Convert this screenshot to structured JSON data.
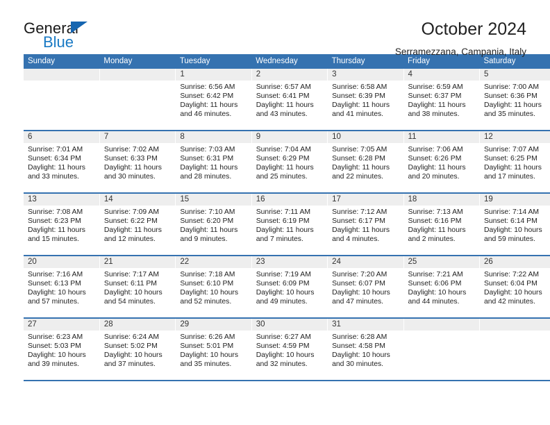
{
  "brand": {
    "name_part1": "General",
    "name_part2": "Blue",
    "triangle_color": "#1565b0",
    "blue_text_color": "#1879c4"
  },
  "header": {
    "title": "October 2024",
    "subtitle": "Serramezzana, Campania, Italy"
  },
  "theme": {
    "header_row_bg": "#3572b0",
    "header_row_text": "#ffffff",
    "daynum_bg": "#eeeeee",
    "row_separator": "#3572b0"
  },
  "weekdays": [
    "Sunday",
    "Monday",
    "Tuesday",
    "Wednesday",
    "Thursday",
    "Friday",
    "Saturday"
  ],
  "labels": {
    "sunrise_prefix": "Sunrise:",
    "sunset_prefix": "Sunset:",
    "daylight_prefix": "Daylight:"
  },
  "weeks": [
    [
      {
        "day": "",
        "sunrise": "",
        "sunset": "",
        "daylight_line1": "",
        "daylight_line2": ""
      },
      {
        "day": "",
        "sunrise": "",
        "sunset": "",
        "daylight_line1": "",
        "daylight_line2": ""
      },
      {
        "day": "1",
        "sunrise": "Sunrise: 6:56 AM",
        "sunset": "Sunset: 6:42 PM",
        "daylight_line1": "Daylight: 11 hours",
        "daylight_line2": "and 46 minutes."
      },
      {
        "day": "2",
        "sunrise": "Sunrise: 6:57 AM",
        "sunset": "Sunset: 6:41 PM",
        "daylight_line1": "Daylight: 11 hours",
        "daylight_line2": "and 43 minutes."
      },
      {
        "day": "3",
        "sunrise": "Sunrise: 6:58 AM",
        "sunset": "Sunset: 6:39 PM",
        "daylight_line1": "Daylight: 11 hours",
        "daylight_line2": "and 41 minutes."
      },
      {
        "day": "4",
        "sunrise": "Sunrise: 6:59 AM",
        "sunset": "Sunset: 6:37 PM",
        "daylight_line1": "Daylight: 11 hours",
        "daylight_line2": "and 38 minutes."
      },
      {
        "day": "5",
        "sunrise": "Sunrise: 7:00 AM",
        "sunset": "Sunset: 6:36 PM",
        "daylight_line1": "Daylight: 11 hours",
        "daylight_line2": "and 35 minutes."
      }
    ],
    [
      {
        "day": "6",
        "sunrise": "Sunrise: 7:01 AM",
        "sunset": "Sunset: 6:34 PM",
        "daylight_line1": "Daylight: 11 hours",
        "daylight_line2": "and 33 minutes."
      },
      {
        "day": "7",
        "sunrise": "Sunrise: 7:02 AM",
        "sunset": "Sunset: 6:33 PM",
        "daylight_line1": "Daylight: 11 hours",
        "daylight_line2": "and 30 minutes."
      },
      {
        "day": "8",
        "sunrise": "Sunrise: 7:03 AM",
        "sunset": "Sunset: 6:31 PM",
        "daylight_line1": "Daylight: 11 hours",
        "daylight_line2": "and 28 minutes."
      },
      {
        "day": "9",
        "sunrise": "Sunrise: 7:04 AM",
        "sunset": "Sunset: 6:29 PM",
        "daylight_line1": "Daylight: 11 hours",
        "daylight_line2": "and 25 minutes."
      },
      {
        "day": "10",
        "sunrise": "Sunrise: 7:05 AM",
        "sunset": "Sunset: 6:28 PM",
        "daylight_line1": "Daylight: 11 hours",
        "daylight_line2": "and 22 minutes."
      },
      {
        "day": "11",
        "sunrise": "Sunrise: 7:06 AM",
        "sunset": "Sunset: 6:26 PM",
        "daylight_line1": "Daylight: 11 hours",
        "daylight_line2": "and 20 minutes."
      },
      {
        "day": "12",
        "sunrise": "Sunrise: 7:07 AM",
        "sunset": "Sunset: 6:25 PM",
        "daylight_line1": "Daylight: 11 hours",
        "daylight_line2": "and 17 minutes."
      }
    ],
    [
      {
        "day": "13",
        "sunrise": "Sunrise: 7:08 AM",
        "sunset": "Sunset: 6:23 PM",
        "daylight_line1": "Daylight: 11 hours",
        "daylight_line2": "and 15 minutes."
      },
      {
        "day": "14",
        "sunrise": "Sunrise: 7:09 AM",
        "sunset": "Sunset: 6:22 PM",
        "daylight_line1": "Daylight: 11 hours",
        "daylight_line2": "and 12 minutes."
      },
      {
        "day": "15",
        "sunrise": "Sunrise: 7:10 AM",
        "sunset": "Sunset: 6:20 PM",
        "daylight_line1": "Daylight: 11 hours",
        "daylight_line2": "and 9 minutes."
      },
      {
        "day": "16",
        "sunrise": "Sunrise: 7:11 AM",
        "sunset": "Sunset: 6:19 PM",
        "daylight_line1": "Daylight: 11 hours",
        "daylight_line2": "and 7 minutes."
      },
      {
        "day": "17",
        "sunrise": "Sunrise: 7:12 AM",
        "sunset": "Sunset: 6:17 PM",
        "daylight_line1": "Daylight: 11 hours",
        "daylight_line2": "and 4 minutes."
      },
      {
        "day": "18",
        "sunrise": "Sunrise: 7:13 AM",
        "sunset": "Sunset: 6:16 PM",
        "daylight_line1": "Daylight: 11 hours",
        "daylight_line2": "and 2 minutes."
      },
      {
        "day": "19",
        "sunrise": "Sunrise: 7:14 AM",
        "sunset": "Sunset: 6:14 PM",
        "daylight_line1": "Daylight: 10 hours",
        "daylight_line2": "and 59 minutes."
      }
    ],
    [
      {
        "day": "20",
        "sunrise": "Sunrise: 7:16 AM",
        "sunset": "Sunset: 6:13 PM",
        "daylight_line1": "Daylight: 10 hours",
        "daylight_line2": "and 57 minutes."
      },
      {
        "day": "21",
        "sunrise": "Sunrise: 7:17 AM",
        "sunset": "Sunset: 6:11 PM",
        "daylight_line1": "Daylight: 10 hours",
        "daylight_line2": "and 54 minutes."
      },
      {
        "day": "22",
        "sunrise": "Sunrise: 7:18 AM",
        "sunset": "Sunset: 6:10 PM",
        "daylight_line1": "Daylight: 10 hours",
        "daylight_line2": "and 52 minutes."
      },
      {
        "day": "23",
        "sunrise": "Sunrise: 7:19 AM",
        "sunset": "Sunset: 6:09 PM",
        "daylight_line1": "Daylight: 10 hours",
        "daylight_line2": "and 49 minutes."
      },
      {
        "day": "24",
        "sunrise": "Sunrise: 7:20 AM",
        "sunset": "Sunset: 6:07 PM",
        "daylight_line1": "Daylight: 10 hours",
        "daylight_line2": "and 47 minutes."
      },
      {
        "day": "25",
        "sunrise": "Sunrise: 7:21 AM",
        "sunset": "Sunset: 6:06 PM",
        "daylight_line1": "Daylight: 10 hours",
        "daylight_line2": "and 44 minutes."
      },
      {
        "day": "26",
        "sunrise": "Sunrise: 7:22 AM",
        "sunset": "Sunset: 6:04 PM",
        "daylight_line1": "Daylight: 10 hours",
        "daylight_line2": "and 42 minutes."
      }
    ],
    [
      {
        "day": "27",
        "sunrise": "Sunrise: 6:23 AM",
        "sunset": "Sunset: 5:03 PM",
        "daylight_line1": "Daylight: 10 hours",
        "daylight_line2": "and 39 minutes."
      },
      {
        "day": "28",
        "sunrise": "Sunrise: 6:24 AM",
        "sunset": "Sunset: 5:02 PM",
        "daylight_line1": "Daylight: 10 hours",
        "daylight_line2": "and 37 minutes."
      },
      {
        "day": "29",
        "sunrise": "Sunrise: 6:26 AM",
        "sunset": "Sunset: 5:01 PM",
        "daylight_line1": "Daylight: 10 hours",
        "daylight_line2": "and 35 minutes."
      },
      {
        "day": "30",
        "sunrise": "Sunrise: 6:27 AM",
        "sunset": "Sunset: 4:59 PM",
        "daylight_line1": "Daylight: 10 hours",
        "daylight_line2": "and 32 minutes."
      },
      {
        "day": "31",
        "sunrise": "Sunrise: 6:28 AM",
        "sunset": "Sunset: 4:58 PM",
        "daylight_line1": "Daylight: 10 hours",
        "daylight_line2": "and 30 minutes."
      },
      {
        "day": "",
        "sunrise": "",
        "sunset": "",
        "daylight_line1": "",
        "daylight_line2": ""
      },
      {
        "day": "",
        "sunrise": "",
        "sunset": "",
        "daylight_line1": "",
        "daylight_line2": ""
      }
    ]
  ]
}
